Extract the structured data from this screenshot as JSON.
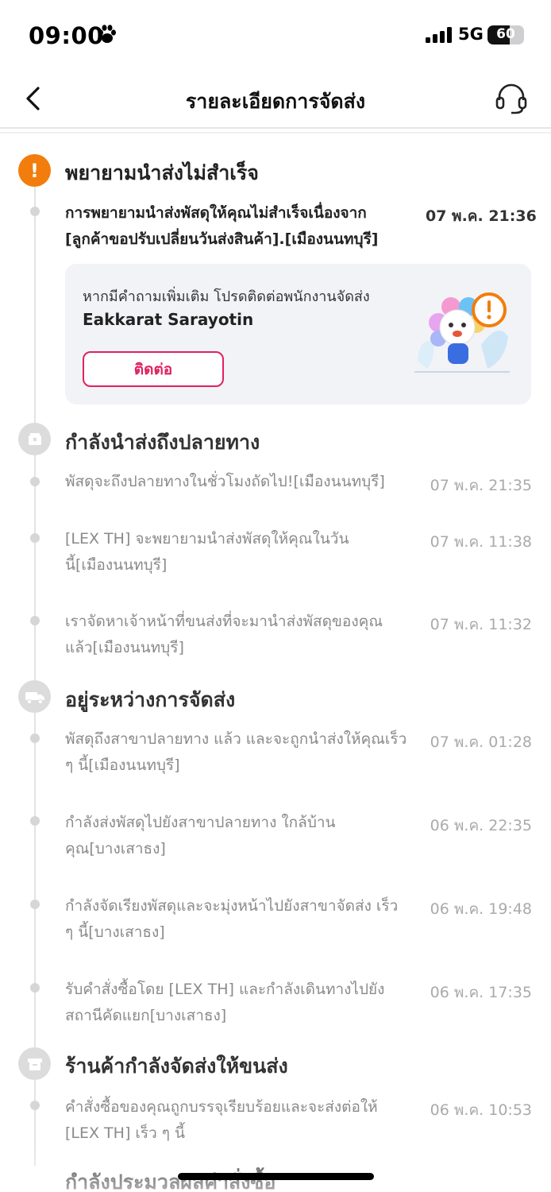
{
  "status_bar": {
    "time": "09:00",
    "network": "5G",
    "battery_level": "60",
    "battery_fraction": 0.6
  },
  "header": {
    "title": "รายละเอียดการจัดส่ง"
  },
  "colors": {
    "alert": "#f27d0c",
    "accent": "#e0215e",
    "card_bg": "#f2f3f7"
  },
  "sections": [
    {
      "title": "พยายามนำส่งไม่สำเร็จ",
      "icon": "alert-icon",
      "events": [
        {
          "lines": [
            "การพยายามนำส่งพัสดุให้คุณไม่สำเร็จเนื่องจาก",
            "[ลูกค้าขอปรับเปลี่ยนวันส่งสินค้า].[เมืองนนทบุรี]"
          ],
          "time": "07 พ.ค. 21:36"
        }
      ],
      "contact": {
        "question": "หากมีคำถามเพิ่มเติม โปรดติดต่อพนักงานจัดส่ง",
        "courier_name": "Eakkarat Sarayotin",
        "button": "ติดต่อ"
      }
    },
    {
      "title": "กำลังนำส่งถึงปลายทาง",
      "icon": "delivery-box-icon",
      "events": [
        {
          "lines": [
            "พัสดุจะถึงปลายทางในชั่วโมงถัดไป![เมืองนนทบุรี]"
          ],
          "time": "07 พ.ค. 21:35"
        },
        {
          "lines": [
            "[LEX TH] จะพยายามนำส่งพัสดุให้คุณในวัน",
            "นี้[เมืองนนทบุรี]"
          ],
          "time": "07 พ.ค. 11:38"
        },
        {
          "lines": [
            "เราจัดหาเจ้าหน้าที่ขนส่งที่จะมานำส่งพัสดุของคุณ",
            "แล้ว[เมืองนนทบุรี]"
          ],
          "time": "07 พ.ค. 11:32"
        }
      ]
    },
    {
      "title": "อยู่ระหว่างการจัดส่ง",
      "icon": "truck-icon",
      "events": [
        {
          "lines": [
            "พัสดุถึงสาขาปลายทาง แล้ว และจะถูกนำส่งให้คุณเร็ว",
            "ๆ นี้[เมืองนนทบุรี]"
          ],
          "time": "07 พ.ค. 01:28"
        },
        {
          "lines": [
            "กำลังส่งพัสดุไปยังสาขาปลายทาง ใกล้บ้าน",
            "คุณ[บางเสาธง]"
          ],
          "time": "06 พ.ค. 22:35"
        },
        {
          "lines": [
            "กำลังจัดเรียงพัสดุและจะมุ่งหน้าไปยังสาขาจัดส่ง เร็ว",
            "ๆ นี้[บางเสาธง]"
          ],
          "time": "06 พ.ค. 19:48"
        },
        {
          "lines": [
            "รับคำสั่งซื้อโดย [LEX TH] และกำลังเดินทางไปยัง",
            "สถานีคัดแยก[บางเสาธง]"
          ],
          "time": "06 พ.ค. 17:35"
        }
      ]
    },
    {
      "title": "ร้านค้ากำลังจัดส่งให้ขนส่ง",
      "icon": "package-icon",
      "events": [
        {
          "lines": [
            "คำสั่งซื้อของคุณถูกบรรจุเรียบร้อยและจะส่งต่อให้",
            "[LEX TH] เร็ว ๆ นี้"
          ],
          "time": "06 พ.ค. 10:53"
        }
      ]
    },
    {
      "title": "กำลังประมวลผลคำสั่งซื้อ",
      "icon": "",
      "events": []
    }
  ]
}
